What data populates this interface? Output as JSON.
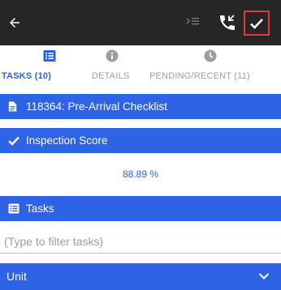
{
  "toolbar": {
    "back_icon": "arrow-left-icon",
    "menu_icon": "indent-menu-icon",
    "call_icon": "phone-callback-icon",
    "confirm_icon": "checkmark-icon",
    "confirm_border_color": "#e53935",
    "background_color": "#262626"
  },
  "tabs": [
    {
      "label": "TASKS (10)",
      "icon": "list-icon",
      "active": true
    },
    {
      "label": "DETAILS",
      "icon": "info-icon",
      "active": false
    },
    {
      "label": "PENDING/RECENT (11)",
      "icon": "clock-icon",
      "active": false
    }
  ],
  "checklist": {
    "title": "118364: Pre-Arrival Checklist",
    "icon": "document-icon"
  },
  "inspection": {
    "label": "Inspection Score",
    "icon": "check-icon",
    "score": "88.89 %"
  },
  "tasks_section": {
    "label": "Tasks",
    "icon": "list-box-icon"
  },
  "filter": {
    "placeholder": "(Type to filter tasks)",
    "value": ""
  },
  "unit": {
    "label": "Unit",
    "icon": "chevron-down-icon"
  },
  "colors": {
    "accent": "#2e63e6",
    "active_tab": "#2962e8",
    "inactive_tab": "#9e9e9e"
  }
}
